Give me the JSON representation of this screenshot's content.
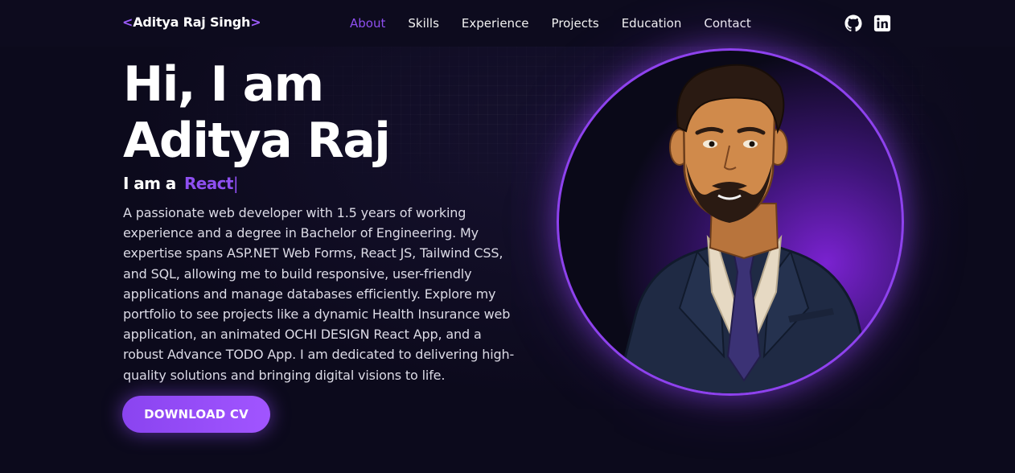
{
  "nav": {
    "brand": {
      "open": "<",
      "name": "Aditya Raj Singh",
      "close": ">"
    },
    "links": [
      "About",
      "Skills",
      "Experience",
      "Projects",
      "Education",
      "Contact"
    ],
    "active": "About",
    "social": [
      "github-icon",
      "linkedin-icon"
    ]
  },
  "hero": {
    "title_line1": "Hi, I am",
    "title_line2": "Aditya Raj",
    "typing_prefix": "I am a",
    "typing_role": "React",
    "typing_cursor": "|",
    "bio": "A passionate web developer with 1.5 years of working experience and a degree in Bachelor of Engineering. My expertise spans ASP.NET Web Forms, React JS, Tailwind CSS, and SQL, allowing me to build responsive, user-friendly applications and manage databases efficiently. Explore my portfolio to see projects like a dynamic Health Insurance web application, an animated OCHI DESIGN React App, and a robust Advance TODO App. I am dedicated to delivering high-quality solutions and bringing digital visions to life.",
    "cta_label": "DOWNLOAD CV"
  },
  "colors": {
    "accent": "#8e4ff0",
    "background": "#0c0a1c",
    "ring": "#8e42ee"
  }
}
